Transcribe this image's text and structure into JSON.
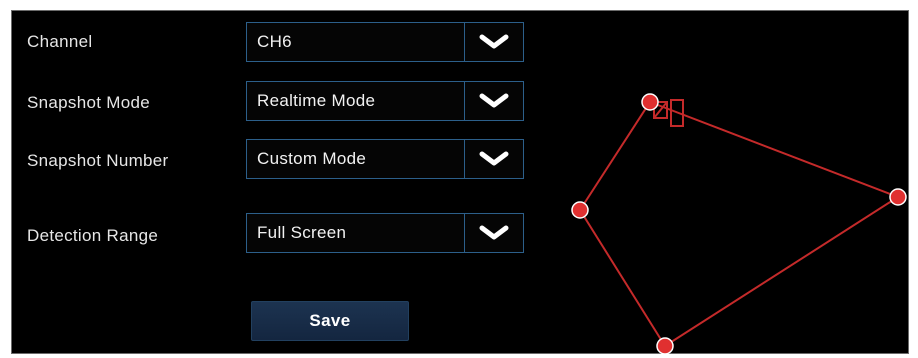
{
  "form": {
    "channel": {
      "label": "Channel",
      "value": "CH6"
    },
    "snapshot_mode": {
      "label": "Snapshot Mode",
      "value": "Realtime Mode"
    },
    "snapshot_number": {
      "label": "Snapshot Number",
      "value": "Custom Mode"
    },
    "detection_range": {
      "label": "Detection Range",
      "value": "Full Screen"
    },
    "save_label": "Save"
  },
  "detection_region": {
    "color": "#e03030",
    "marker_icon": "flag-icon"
  },
  "colors": {
    "panel_bg": "#000000",
    "field_border": "#2c5f8a",
    "button_bg": "#1c3350",
    "handle": "#e03030"
  }
}
